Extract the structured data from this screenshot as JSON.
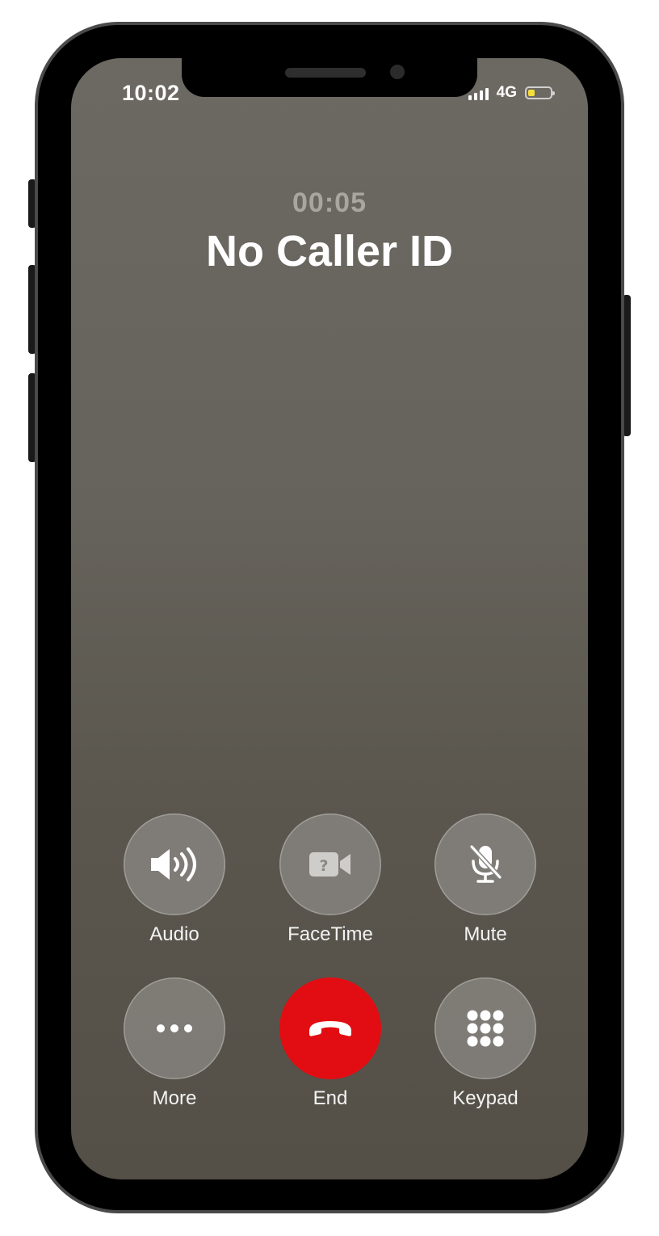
{
  "status_bar": {
    "time": "10:02",
    "network": "4G",
    "battery_level": 0.3
  },
  "call": {
    "duration": "00:05",
    "caller": "No Caller ID"
  },
  "controls": [
    {
      "label": "Audio",
      "icon": "speaker-icon"
    },
    {
      "label": "FaceTime",
      "icon": "facetime-icon"
    },
    {
      "label": "Mute",
      "icon": "mic-off-icon"
    },
    {
      "label": "More",
      "icon": "ellipsis-icon"
    },
    {
      "label": "End",
      "icon": "end-call-icon"
    },
    {
      "label": "Keypad",
      "icon": "keypad-icon"
    }
  ],
  "colors": {
    "end_button": "#e20d12",
    "battery_fill": "#f5de3b"
  }
}
